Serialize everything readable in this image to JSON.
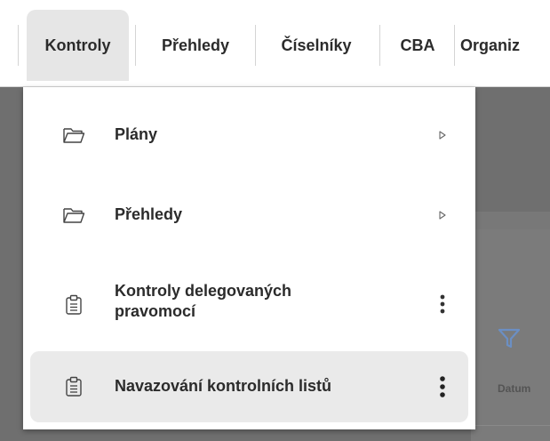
{
  "menubar": {
    "tabs": [
      {
        "label": "Kontroly",
        "active": true
      },
      {
        "label": "Přehledy",
        "active": false
      },
      {
        "label": "Číselníky",
        "active": false
      },
      {
        "label": "CBA",
        "active": false
      },
      {
        "label": "Organiz",
        "active": false
      }
    ]
  },
  "dropdown": {
    "items": [
      {
        "label": "Plány",
        "icon": "folder-icon",
        "trailing": "submenu-arrow-icon"
      },
      {
        "label": "Přehledy",
        "icon": "folder-icon",
        "trailing": "submenu-arrow-icon"
      },
      {
        "label_line1": "Kontroly delegovaných",
        "label_line2": "pravomocí",
        "icon": "clipboard-icon",
        "trailing": "more-vertical-icon"
      },
      {
        "label": "Navazování kontrolních listů",
        "icon": "clipboard-icon",
        "trailing": "more-vertical-icon",
        "active": true
      }
    ]
  },
  "background": {
    "partial_text": "Datum",
    "filter_color": "#5a8fd6"
  }
}
